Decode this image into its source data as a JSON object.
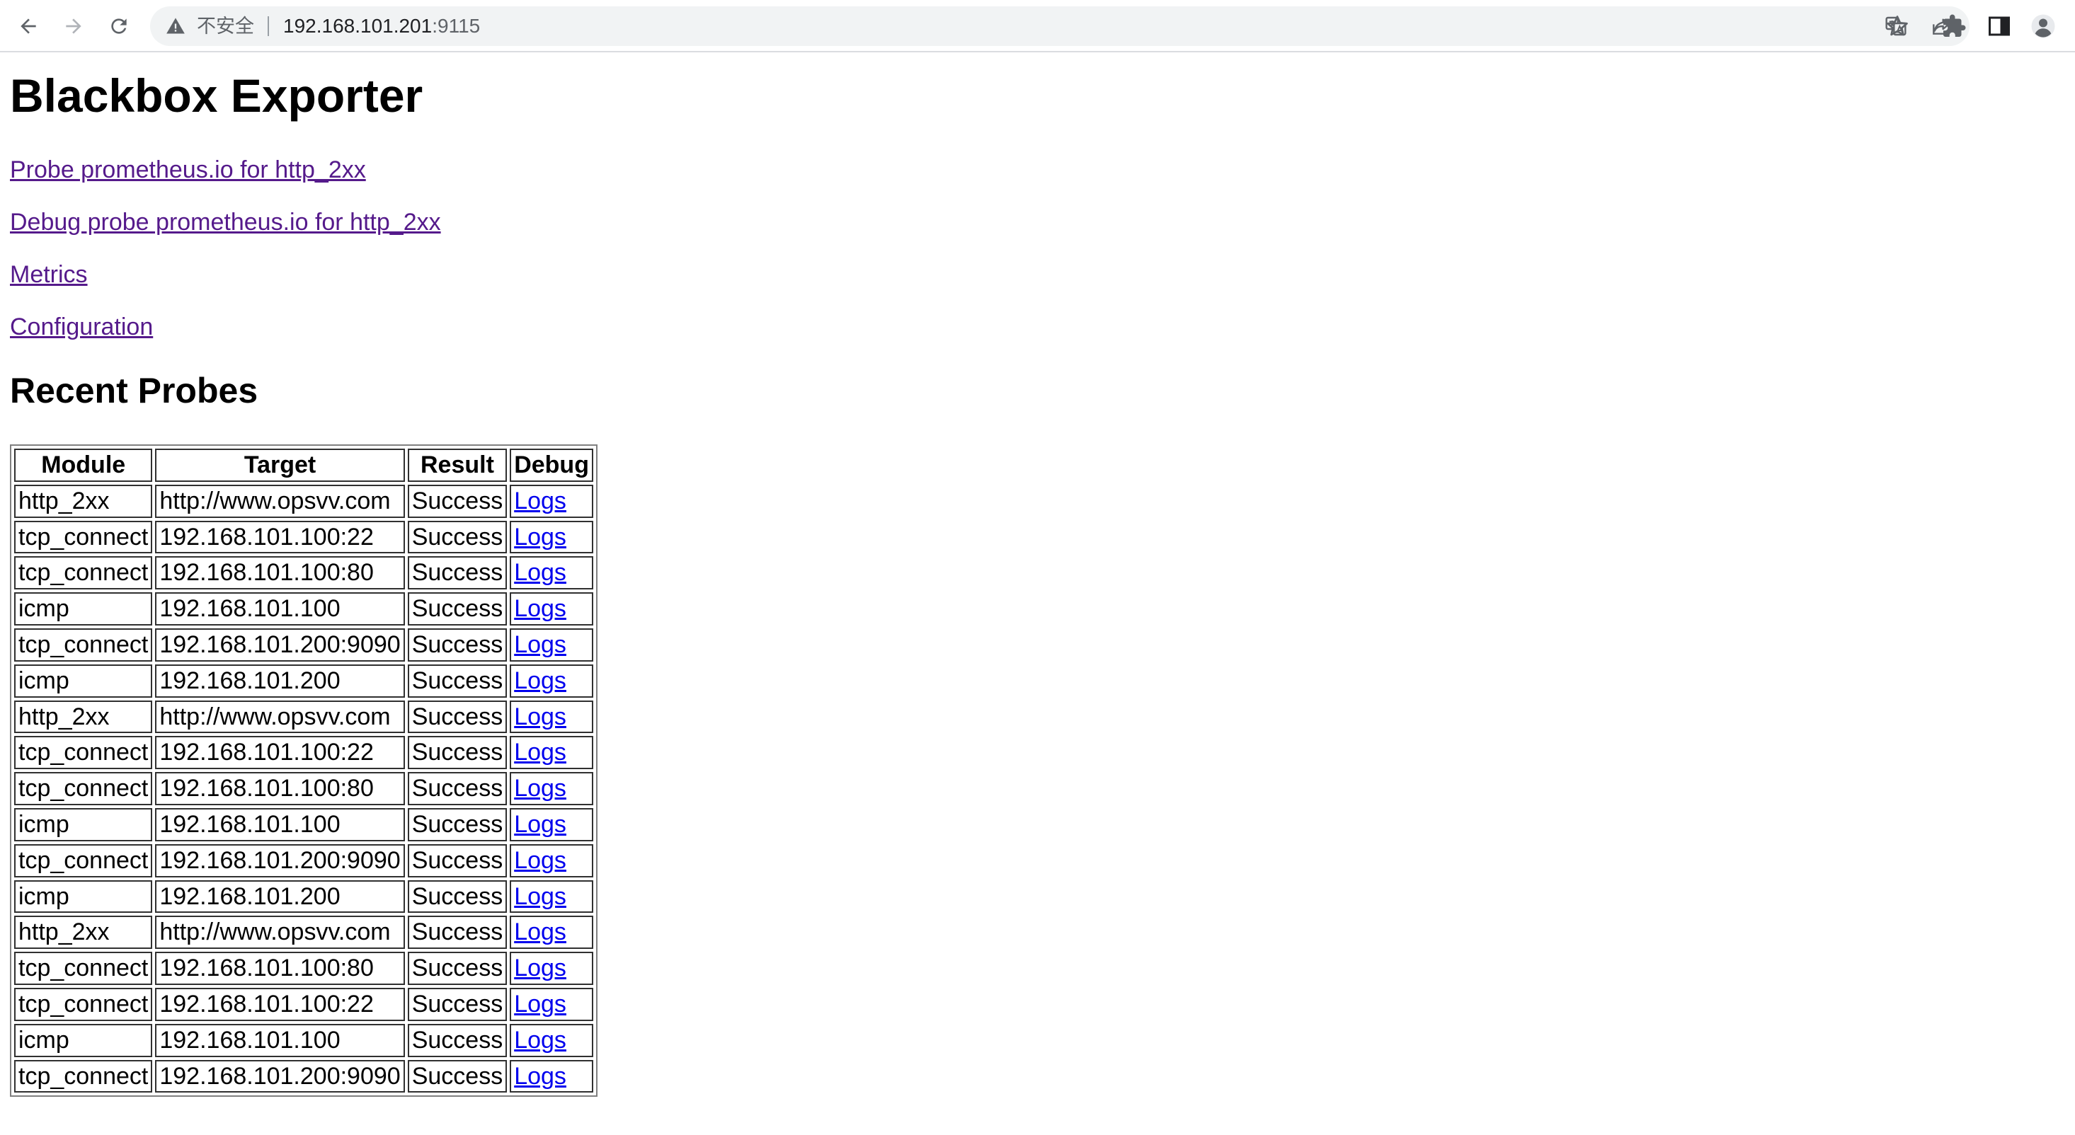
{
  "browser": {
    "security_label": "不安全",
    "url_host": "192.168.101.201",
    "url_port": ":9115"
  },
  "page": {
    "title": "Blackbox Exporter",
    "links": [
      "Probe prometheus.io for http_2xx",
      "Debug probe prometheus.io for http_2xx",
      "Metrics",
      "Configuration"
    ],
    "section_title": "Recent Probes"
  },
  "table": {
    "headers": [
      "Module",
      "Target",
      "Result",
      "Debug"
    ],
    "rows": [
      [
        "http_2xx",
        "http://www.opsvv.com",
        "Success",
        "Logs"
      ],
      [
        "tcp_connect",
        "192.168.101.100:22",
        "Success",
        "Logs"
      ],
      [
        "tcp_connect",
        "192.168.101.100:80",
        "Success",
        "Logs"
      ],
      [
        "icmp",
        "192.168.101.100",
        "Success",
        "Logs"
      ],
      [
        "tcp_connect",
        "192.168.101.200:9090",
        "Success",
        "Logs"
      ],
      [
        "icmp",
        "192.168.101.200",
        "Success",
        "Logs"
      ],
      [
        "http_2xx",
        "http://www.opsvv.com",
        "Success",
        "Logs"
      ],
      [
        "tcp_connect",
        "192.168.101.100:22",
        "Success",
        "Logs"
      ],
      [
        "tcp_connect",
        "192.168.101.100:80",
        "Success",
        "Logs"
      ],
      [
        "icmp",
        "192.168.101.100",
        "Success",
        "Logs"
      ],
      [
        "tcp_connect",
        "192.168.101.200:9090",
        "Success",
        "Logs"
      ],
      [
        "icmp",
        "192.168.101.200",
        "Success",
        "Logs"
      ],
      [
        "http_2xx",
        "http://www.opsvv.com",
        "Success",
        "Logs"
      ],
      [
        "tcp_connect",
        "192.168.101.100:80",
        "Success",
        "Logs"
      ],
      [
        "tcp_connect",
        "192.168.101.100:22",
        "Success",
        "Logs"
      ],
      [
        "icmp",
        "192.168.101.100",
        "Success",
        "Logs"
      ],
      [
        "tcp_connect",
        "192.168.101.200:9090",
        "Success",
        "Logs"
      ]
    ]
  },
  "icons": {
    "back": "back-arrow-icon",
    "forward": "forward-arrow-icon",
    "reload": "reload-icon",
    "warning": "warning-icon",
    "translate": "translate-icon",
    "share": "share-icon",
    "bookmark": "star-icon",
    "extensions": "puzzle-icon",
    "side_panel": "side-panel-icon",
    "profile": "profile-avatar-icon"
  },
  "colors": {
    "visited_link": "#551a8b",
    "unvisited_link": "#0000ee"
  }
}
